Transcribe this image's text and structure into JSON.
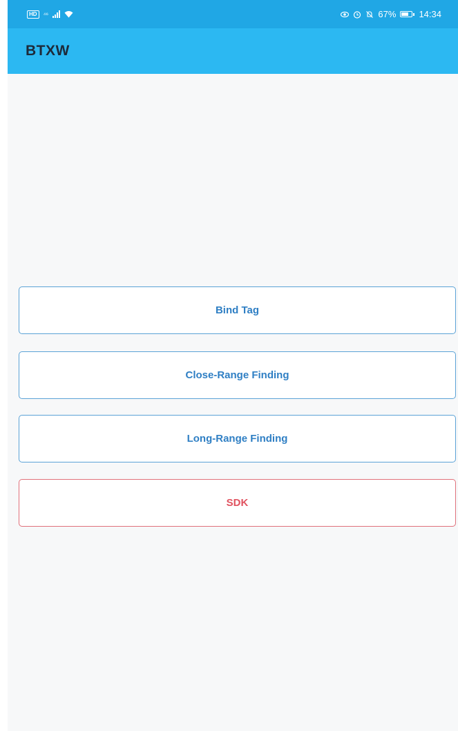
{
  "status_bar": {
    "signal_label": "⁴⁶",
    "battery_percent": "67%",
    "time": "14:34",
    "icons": [
      "hd-icon",
      "signal-icon",
      "wifi-icon",
      "eye-icon",
      "alarm-icon",
      "mute-icon",
      "battery-icon"
    ]
  },
  "app_bar": {
    "title": "BTXW",
    "color": "#2cb8f2"
  },
  "buttons": {
    "bind_tag": "Bind Tag",
    "close_range": "Close-Range Finding",
    "long_range": "Long-Range Finding",
    "sdk": "SDK"
  },
  "colors": {
    "status_bar": "#20a7e5",
    "primary_text": "#2f7fc4",
    "sdk_text": "#e0525f",
    "background": "#f7f8f9"
  }
}
